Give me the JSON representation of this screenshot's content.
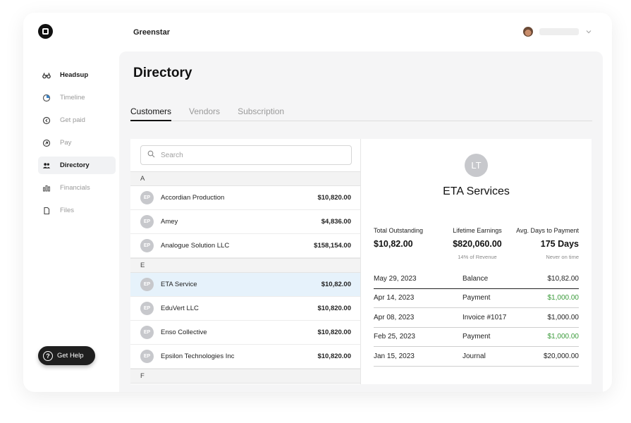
{
  "header": {
    "org_name": "Greenstar"
  },
  "sidebar": {
    "items": [
      {
        "label": "Headsup",
        "icon": "binoculars-icon"
      },
      {
        "label": "Timeline",
        "icon": "pie-chart-icon"
      },
      {
        "label": "Get paid",
        "icon": "arrow-in-circle-icon"
      },
      {
        "label": "Pay",
        "icon": "arrow-out-circle-icon"
      },
      {
        "label": "Directory",
        "icon": "users-icon"
      },
      {
        "label": "Financials",
        "icon": "bar-chart-icon"
      },
      {
        "label": "Files",
        "icon": "file-icon"
      }
    ],
    "help_label": "Get Help"
  },
  "page": {
    "title": "Directory",
    "tabs": [
      "Customers",
      "Vendors",
      "Subscription"
    ],
    "active_tab": "Customers"
  },
  "list": {
    "search_placeholder": "Search",
    "groups": [
      {
        "letter": "A",
        "rows": [
          {
            "initials": "EP",
            "name": "Accordian Production",
            "amount": "$10,820.00"
          },
          {
            "initials": "EP",
            "name": "Amey",
            "amount": "$4,836.00"
          },
          {
            "initials": "EP",
            "name": "Analogue Solution LLC",
            "amount": "$158,154.00"
          }
        ]
      },
      {
        "letter": "E",
        "rows": [
          {
            "initials": "EP",
            "name": "ETA Service",
            "amount": "$10,82.00",
            "selected": true
          },
          {
            "initials": "EP",
            "name": "EduVert LLC",
            "amount": "$10,820.00"
          },
          {
            "initials": "EP",
            "name": "Enso Collective",
            "amount": "$10,820.00"
          },
          {
            "initials": "EP",
            "name": "Epsilon Technologies Inc",
            "amount": "$10,820.00"
          }
        ]
      },
      {
        "letter": "F",
        "rows": []
      }
    ]
  },
  "detail": {
    "initials": "LT",
    "name": "ETA Services",
    "stats": {
      "total_outstanding": {
        "label": "Total Outstanding",
        "value": "$10,82.00"
      },
      "lifetime_earnings": {
        "label": "Lifetime Earnings",
        "value": "$820,060.00",
        "sub": "14% of Revenue"
      },
      "avg_days": {
        "label": "Avg. Days to Payment",
        "value": "175 Days",
        "sub": "Never on time"
      }
    },
    "transactions": [
      {
        "date": "May 29, 2023",
        "type": "Balance",
        "amount": "$10,82.00",
        "color": "#222222"
      },
      {
        "date": "Apr 14, 2023",
        "type": "Payment",
        "amount": "$1,000.00",
        "color": "#3a9b3a"
      },
      {
        "date": "Apr 08, 2023",
        "type": "Invoice #1017",
        "amount": "$1,000.00",
        "color": "#222222"
      },
      {
        "date": "Feb 25, 2023",
        "type": "Payment",
        "amount": "$1,000.00",
        "color": "#3a9b3a"
      },
      {
        "date": "Jan 15, 2023",
        "type": "Journal",
        "amount": "$20,000.00",
        "color": "#222222"
      }
    ]
  }
}
